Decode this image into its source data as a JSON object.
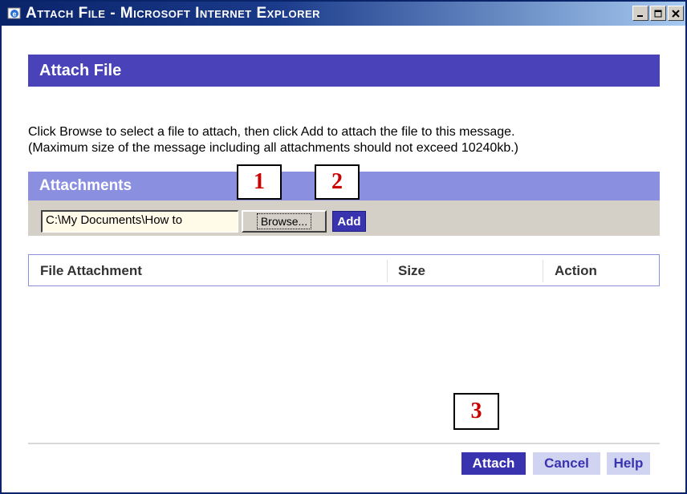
{
  "window": {
    "title": "Attach File - Microsoft Internet Explorer",
    "controls": [
      "minimize",
      "maximize",
      "close"
    ]
  },
  "page": {
    "heading": "Attach File",
    "instructions": [
      "Click Browse to select a file to attach, then click Add to attach the file to this message.",
      "(Maximum size of the message including all attachments should not exceed 10240kb.)"
    ]
  },
  "attachments": {
    "heading": "Attachments",
    "file_value": "C:\\My Documents\\How to",
    "browse_label": "Browse...",
    "add_label": "Add"
  },
  "table": {
    "columns": [
      "File Attachment",
      "Size",
      "Action"
    ]
  },
  "footer": {
    "attach_label": "Attach",
    "cancel_label": "Cancel",
    "help_label": "Help"
  },
  "callouts": [
    "1",
    "2",
    "3"
  ],
  "colors": {
    "header_bar": "#4a42b8",
    "section_bar": "#8b8fe0",
    "primary_button": "#3a33b0",
    "secondary_button": "#d0d4f0",
    "callout_text": "#cc0000"
  },
  "icons": {
    "title_icon": "internet-explorer-icon"
  }
}
